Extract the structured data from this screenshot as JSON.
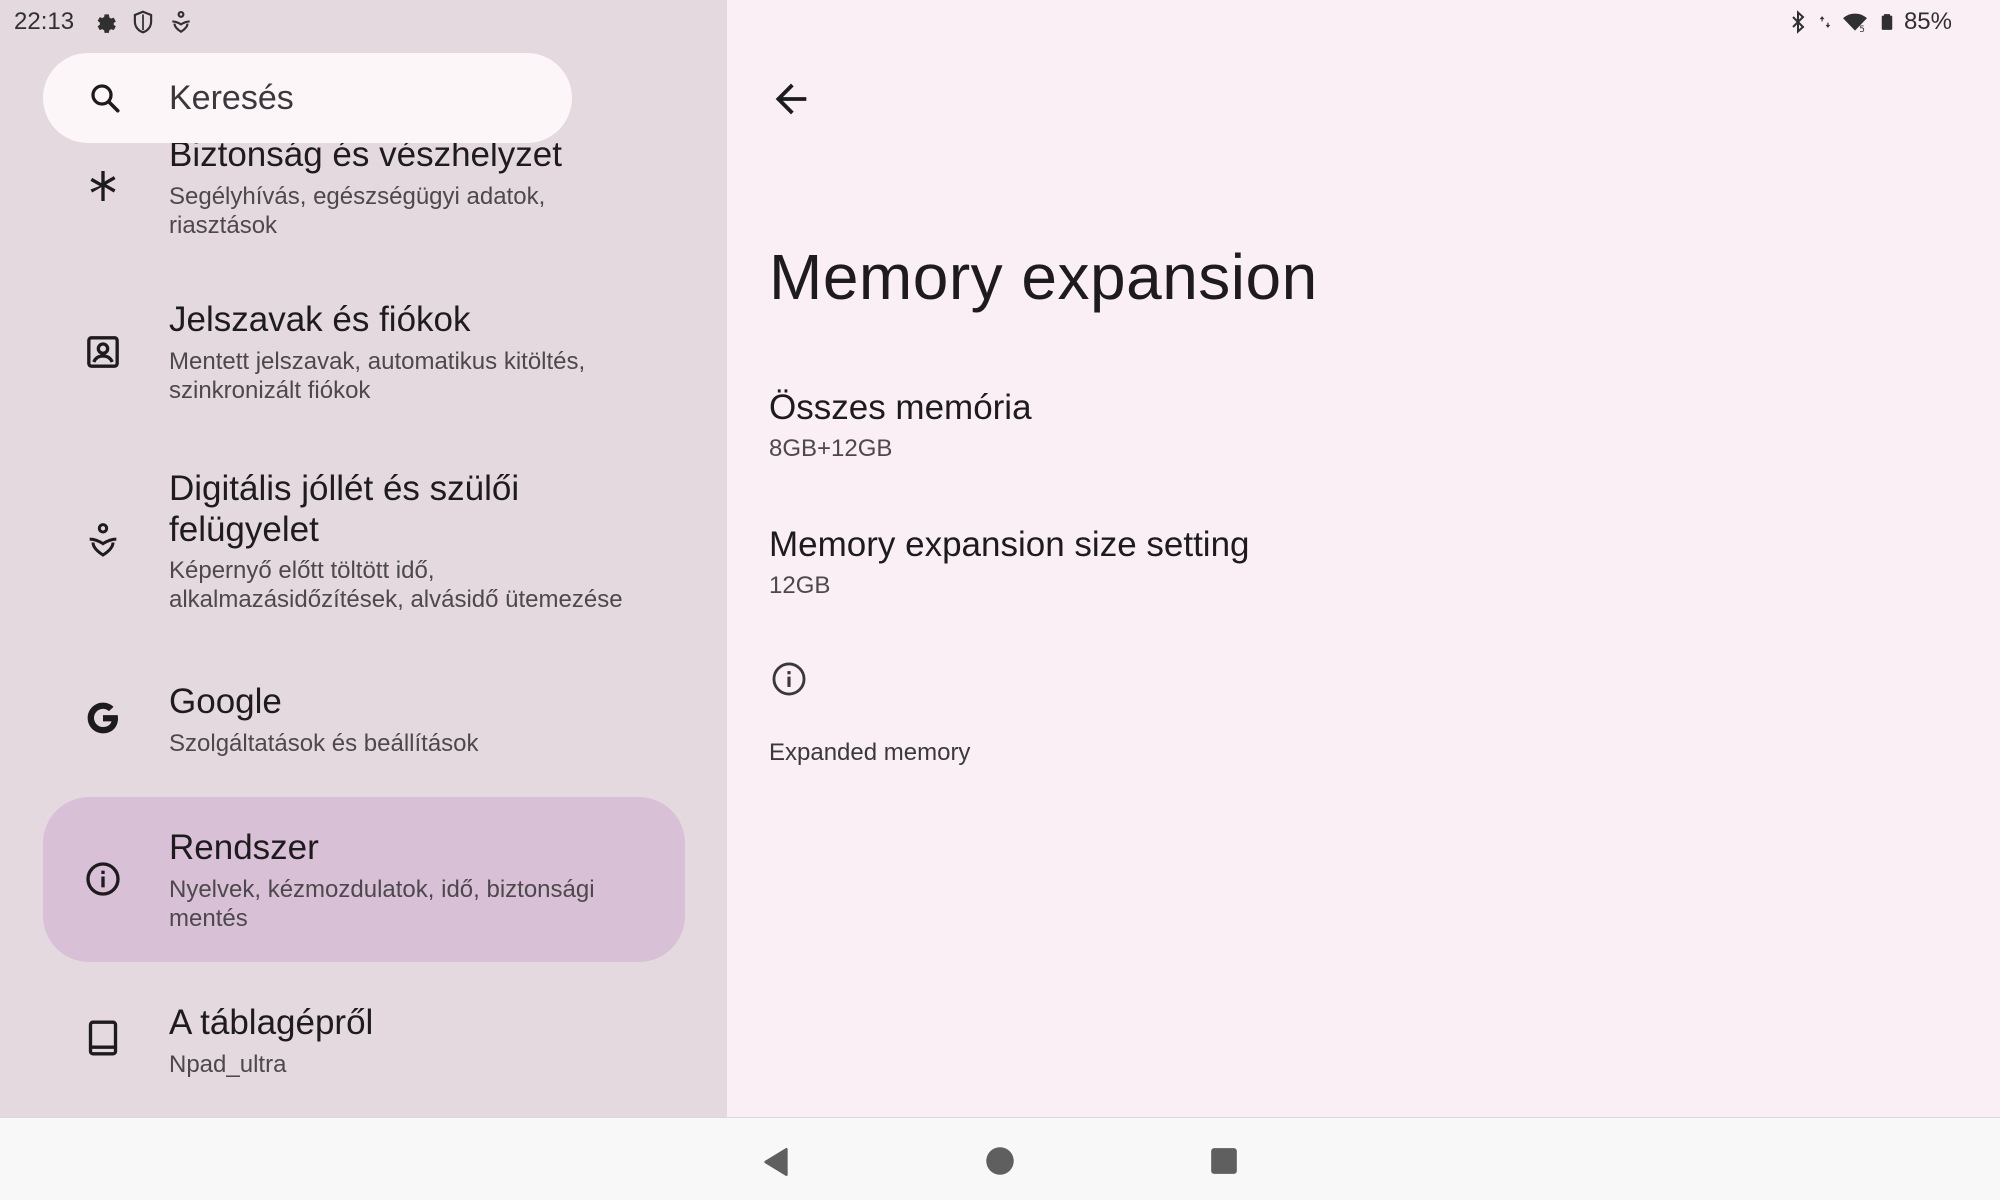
{
  "status_bar": {
    "time": "22:13",
    "left_icons": [
      "gear-icon",
      "shield-icon",
      "digital-wellbeing-icon"
    ],
    "right_icons": [
      "bluetooth-icon",
      "data-arrows-icon",
      "wifi-icon",
      "battery-icon"
    ],
    "battery_percent": "85%"
  },
  "search": {
    "placeholder": "Keresés"
  },
  "menu": {
    "items": [
      {
        "title": "Biztonság és vészhelyzet",
        "subtitle_line1": "Segélyhívás, egészségügyi adatok,",
        "subtitle_line2": "riasztások",
        "icon": "asterisk-icon"
      },
      {
        "title": "Jelszavak és fiókok",
        "subtitle_line1": "Mentett jelszavak, automatikus kitöltés,",
        "subtitle_line2": "szinkronizált fiókok",
        "icon": "account-box-icon"
      },
      {
        "title_line1": "Digitális jóllét és szülői",
        "title_line2": "felügyelet",
        "subtitle_line1": "Képernyő előtt töltött idő,",
        "subtitle_line2": "alkalmazásidőzítések, alvásidő ütemezése",
        "icon": "digital-wellbeing-icon"
      },
      {
        "title": "Google",
        "subtitle_line1": "Szolgáltatások és beállítások",
        "icon": "google-icon"
      },
      {
        "title": "Rendszer",
        "subtitle_line1": "Nyelvek, kézmozdulatok, idő, biztonsági",
        "subtitle_line2": "mentés",
        "icon": "info-icon",
        "selected": true
      },
      {
        "title": "A táblagépről",
        "subtitle_line1": "Npad_ultra",
        "icon": "tablet-icon"
      }
    ]
  },
  "detail": {
    "title": "Memory expansion",
    "prefs": [
      {
        "title": "Összes memória",
        "summary": "8GB+12GB"
      },
      {
        "title": "Memory expansion size setting",
        "summary": "12GB"
      }
    ],
    "footer": "Expanded memory"
  },
  "colors": {
    "left_pane_bg": "#e4d9df",
    "right_pane_bg": "#f9eff4",
    "selected_item_bg": "#d8c1d6",
    "search_bg": "#fcf6f9",
    "nav_bar_bg": "#f8f8f8"
  }
}
